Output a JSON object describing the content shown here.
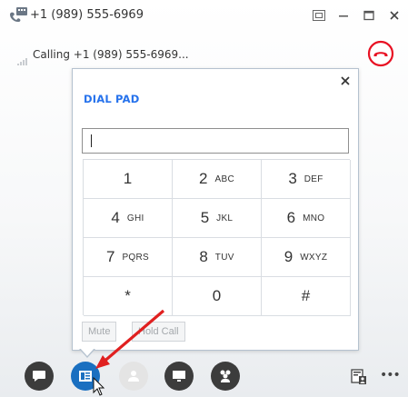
{
  "window": {
    "title": "+1 (989) 555-6969",
    "icons": [
      "call-window-icon",
      "compact-view-icon",
      "minimize-icon",
      "maximize-icon",
      "close-icon"
    ]
  },
  "call_status": {
    "text": "Calling +1 (989) 555-6969..."
  },
  "dial_pad": {
    "title": "DIAL PAD",
    "input_value": "",
    "keys": [
      {
        "digit": "1",
        "letters": ""
      },
      {
        "digit": "2",
        "letters": "ABC"
      },
      {
        "digit": "3",
        "letters": "DEF"
      },
      {
        "digit": "4",
        "letters": "GHI"
      },
      {
        "digit": "5",
        "letters": "JKL"
      },
      {
        "digit": "6",
        "letters": "MNO"
      },
      {
        "digit": "7",
        "letters": "PQRS"
      },
      {
        "digit": "8",
        "letters": "TUV"
      },
      {
        "digit": "9",
        "letters": "WXYZ"
      },
      {
        "digit": "*",
        "letters": ""
      },
      {
        "digit": "0",
        "letters": ""
      },
      {
        "digit": "#",
        "letters": ""
      }
    ],
    "mute_label": "Mute",
    "hold_label": "Hold Call"
  },
  "toolbar": {
    "buttons": [
      "im-icon",
      "dialpad-icon",
      "video-icon",
      "present-icon",
      "participants-icon",
      "contact-card-icon",
      "more-icon"
    ],
    "more_label": "•••"
  },
  "colors": {
    "accent_blue": "#2672ec",
    "dialpad_button": "#1a6fc0",
    "hangup_red": "#e81123",
    "toolbar_icon": "#3c3c3c",
    "arrow_red": "#e02020"
  }
}
